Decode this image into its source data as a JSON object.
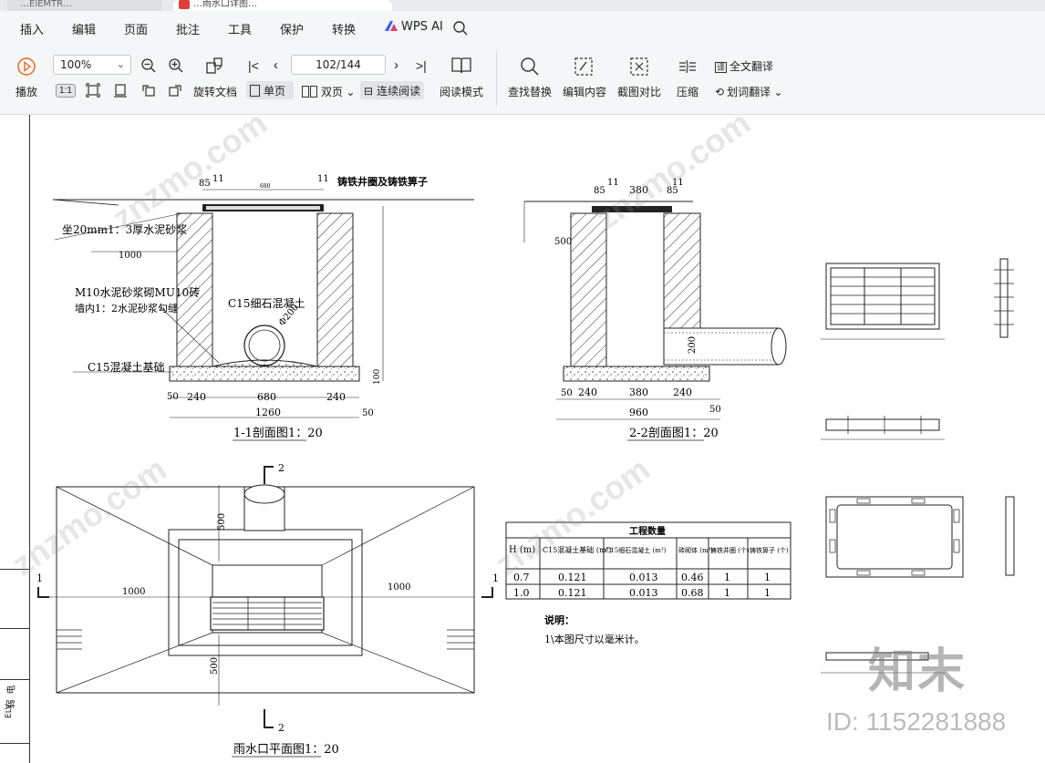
{
  "tabs": [
    {
      "label": "…ElEMTR…"
    },
    {
      "label": "…雨水口详图…"
    }
  ],
  "menu": {
    "items": [
      "插入",
      "编辑",
      "页面",
      "批注",
      "工具",
      "保护",
      "转换"
    ],
    "ai_label": "WPS AI"
  },
  "toolbar": {
    "play_label": "播放",
    "zoom_value": "100%",
    "page_indicator": "102/144",
    "rotate_label": "旋转文档",
    "single_page_label": "单页",
    "double_page_label": "双页",
    "continuous_label": "连续阅读",
    "reading_mode_label": "阅读模式",
    "find_replace_label": "查找替换",
    "edit_content_label": "编辑内容",
    "screenshot_compare_label": "截图对比",
    "compress_label": "压缩",
    "full_translate_label": "全文翻译",
    "word_translate_label": "划词翻译",
    "ratio_label": "1:1"
  },
  "drawing": {
    "section11": {
      "title": "1-1剖面图1：20",
      "cast_iron_label": "铸铁井圈及铸铁箅子",
      "mortar_label": "坐20mm1：3厚水泥砂浆",
      "wall_label_1": "M10水泥砂浆砌MU10砖",
      "wall_label_2": "墙内1：2水泥砂浆勾缝",
      "fill_label": "C15细石混凝土",
      "base_label": "C15混凝土基础",
      "pipe_label": "Φ200",
      "dims": {
        "d85": "85",
        "d11": "11",
        "d680": "680",
        "d1000": "1000",
        "d50": "50",
        "d240": "240",
        "d1260": "1260",
        "d100": "100"
      }
    },
    "section22": {
      "title": "2-2剖面图1：20",
      "dims": {
        "d85": "85",
        "d380": "380",
        "d11": "11",
        "d500": "500",
        "d200": "200",
        "d240": "240",
        "d960": "960",
        "d50": "50"
      }
    },
    "plan": {
      "title": "雨水口平面图1：20",
      "dims": {
        "d500": "500",
        "d1000": "1000"
      },
      "marks": {
        "m1": "1",
        "m2": "2"
      }
    },
    "quantity_table": {
      "title": "工程数量",
      "headers": [
        "H (m)",
        "C15混凝土基础 (m³)",
        "C15细石混凝土 (m³)",
        "砖砌体 (m³)",
        "铸铁井圈 (个)",
        "铸铁箅子 (个)"
      ],
      "rows": [
        [
          "0.7",
          "0.121",
          "0.013",
          "0.46",
          "1",
          "1"
        ],
        [
          "1.0",
          "0.121",
          "0.013",
          "0.68",
          "1",
          "1"
        ]
      ]
    },
    "notes": {
      "heading": "说明：",
      "line1": "1\\本图尺寸以毫米计。"
    },
    "titleblock": {
      "label1": "弱",
      "label2": "电",
      "label3": "ELV"
    }
  },
  "watermark": {
    "site": "znzmo.com",
    "brand": "知末",
    "id_text": "ID: 1152281888"
  }
}
